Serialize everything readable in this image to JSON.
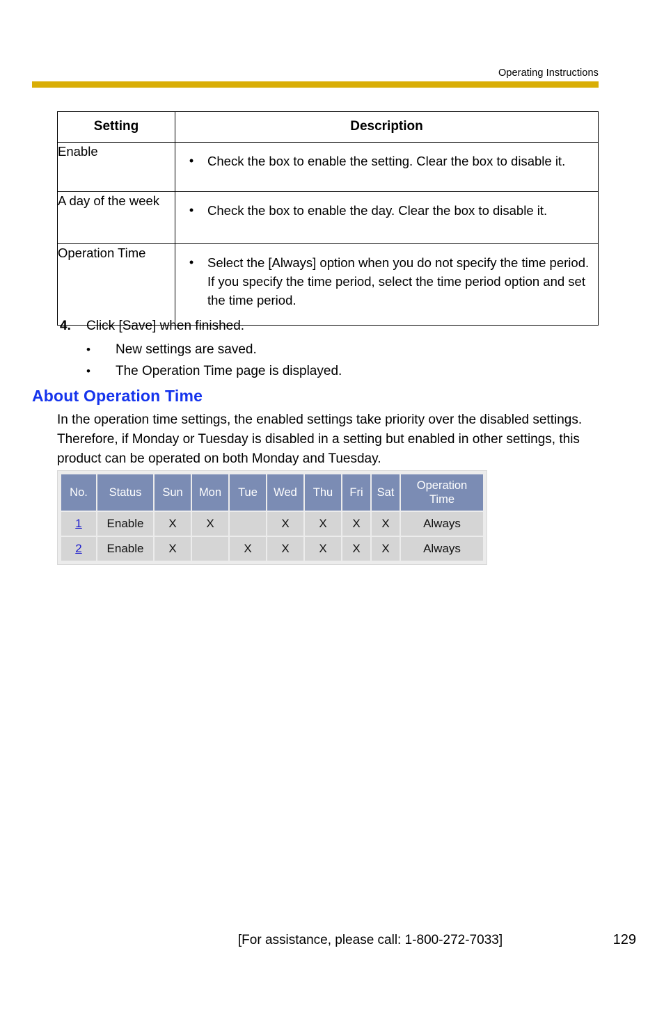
{
  "header": {
    "title": "Operating Instructions",
    "rule_color": "#d9ae06"
  },
  "settings_table": {
    "columns": [
      "Setting",
      "Description"
    ],
    "rows": [
      {
        "setting": "Enable",
        "bullet": "•",
        "description": "Check the box to enable the setting. Clear the box to disable it."
      },
      {
        "setting": "A day of the week",
        "bullet": "•",
        "description": "Check the box to enable the day. Clear the box to disable it."
      },
      {
        "setting": "Operation Time",
        "bullet": "•",
        "description": "Select the [Always] option when you do not specify the time period. If you specify the time period, select the time period option and set the time period."
      }
    ]
  },
  "step": {
    "number": "4.",
    "text": "Click [Save] when finished.",
    "bullet_glyph": "•",
    "bullets": [
      "New settings are saved.",
      "The Operation Time page is displayed."
    ]
  },
  "about": {
    "heading": "About Operation Time",
    "heading_color": "#1433ec",
    "body": "In the operation time settings, the enabled settings take priority over the disabled settings. Therefore, if Monday or Tuesday is disabled in a setting but enabled in other settings, this product can be operated on both Monday and Tuesday."
  },
  "screenshot_table": {
    "header_bg": "#7b8cb4",
    "cell_bg": "#d5d5d5",
    "link_color": "#1a1acc",
    "columns": [
      "No.",
      "Status",
      "Sun",
      "Mon",
      "Tue",
      "Wed",
      "Thu",
      "Fri",
      "Sat",
      "Operation Time"
    ],
    "operation_time_header_lines": [
      "Operation",
      "Time"
    ],
    "mark": "X",
    "rows": [
      {
        "no": "1",
        "status": "Enable",
        "sun": "X",
        "mon": "X",
        "tue": "",
        "wed": "X",
        "thu": "X",
        "fri": "X",
        "sat": "X",
        "operation_time": "Always"
      },
      {
        "no": "2",
        "status": "Enable",
        "sun": "X",
        "mon": "",
        "tue": "X",
        "wed": "X",
        "thu": "X",
        "fri": "X",
        "sat": "X",
        "operation_time": "Always"
      }
    ]
  },
  "footer": {
    "assistance": "[For assistance, please call: 1-800-272-7033]",
    "page_number": "129"
  }
}
